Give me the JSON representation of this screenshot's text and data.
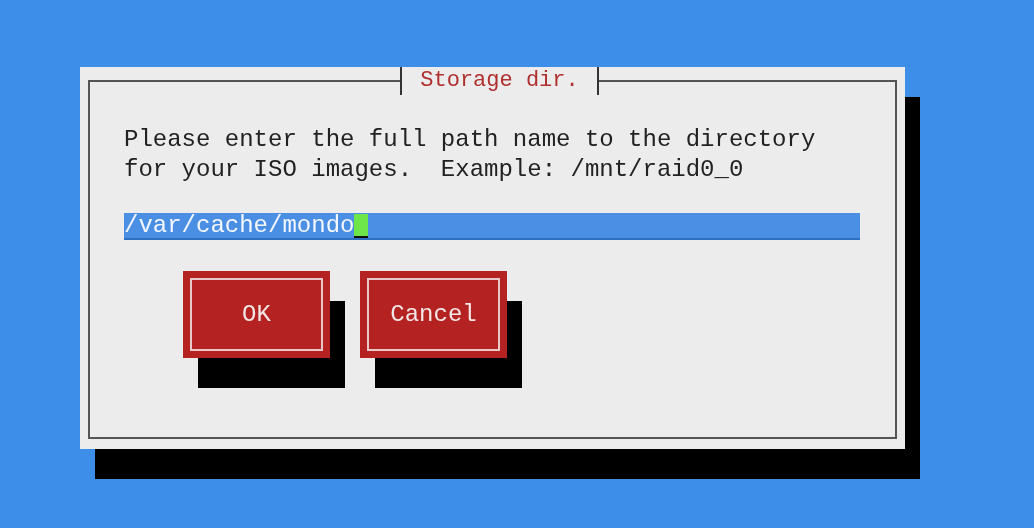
{
  "dialog": {
    "title": "Storage dir.",
    "message": "Please enter the full path name to the directory for your ISO images.  Example: /mnt/raid0_0",
    "input": {
      "value": "/var/cache/mondo",
      "focused": true
    },
    "buttons": [
      {
        "label": "OK"
      },
      {
        "label": "Cancel"
      }
    ]
  }
}
